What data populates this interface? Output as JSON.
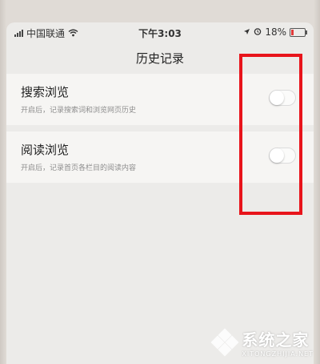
{
  "status_bar": {
    "carrier": "中国联通",
    "time": "下午3:03",
    "battery": "18%",
    "battery_level": 0.18
  },
  "nav": {
    "title": "历史记录"
  },
  "settings": [
    {
      "title": "搜索浏览",
      "subtitle": "开启后，记录搜索词和浏览网页历史",
      "enabled": false
    },
    {
      "title": "阅读浏览",
      "subtitle": "开启后，记录首页各栏目的阅读内容",
      "enabled": false
    }
  ],
  "annotation": {
    "color": "#e8141b"
  },
  "watermark": {
    "name": "系统之家",
    "domain": "XITONGZHIJIA.NET"
  }
}
